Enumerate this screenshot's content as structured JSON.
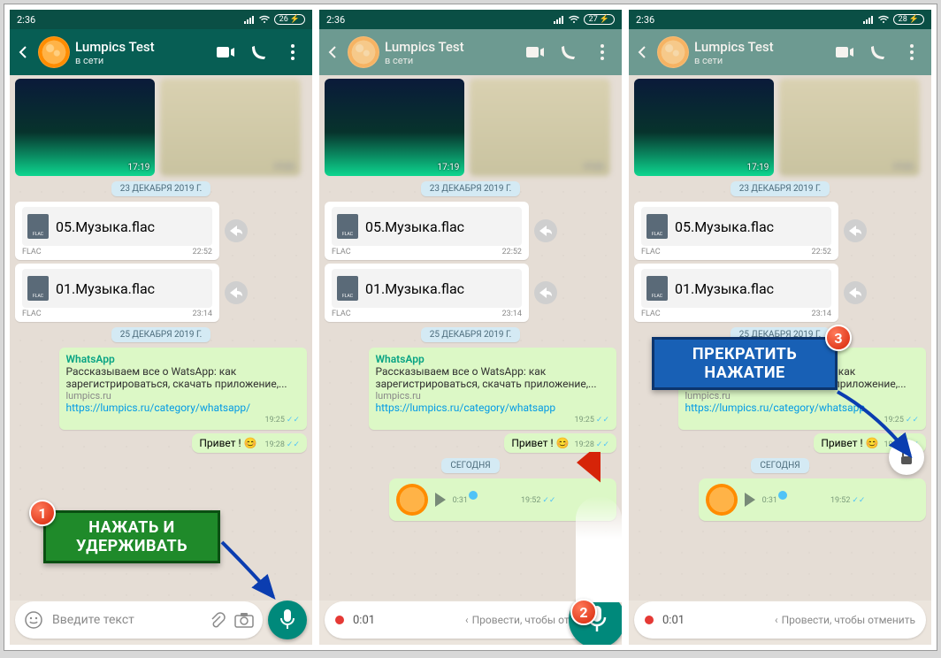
{
  "status": {
    "time": "2:36",
    "batteries": [
      "26",
      "27",
      "28"
    ]
  },
  "header": {
    "contact_name": "Lumpics Test",
    "status_text": "в сети"
  },
  "dates": {
    "d1": "23 ДЕКАБРЯ 2019 Г.",
    "d2": "25 ДЕКАБРЯ 2019 Г.",
    "today": "СЕГОДНЯ"
  },
  "media": {
    "t1": "17:19",
    "t2": "17:21"
  },
  "files": [
    {
      "name": "05.Музыка.flac",
      "ext": "FLAC",
      "time": "22:52"
    },
    {
      "name": "01.Музыка.flac",
      "ext": "FLAC",
      "time": "23:14"
    }
  ],
  "linkmsg": {
    "title": "WhatsApp",
    "body": "Рассказываем все о WatsApp: как зарегистрироваться, скачать приложение,...",
    "domain": "lumpics.ru",
    "url_full": "https://lumpics.ru/category/whatsapp/",
    "url_trunc": "https://lumpics.ru/category/whatsapp",
    "time": "19:25"
  },
  "hello": {
    "text": "Привет ! 😊",
    "time": "19:28"
  },
  "voice": {
    "dur": "0:31",
    "time": "19:52"
  },
  "input": {
    "placeholder": "Введите текст",
    "rec_time": "0:01",
    "slide_cancel": "Провести, чтобы отменить"
  },
  "callouts": {
    "c1a": "НАЖАТЬ И",
    "c1b": "УДЕРЖИВАТЬ",
    "c3a": "ПРЕКРАТИТЬ",
    "c3b": "НАЖАТИЕ"
  },
  "badges": {
    "n1": "1",
    "n2": "2",
    "n3": "3"
  }
}
